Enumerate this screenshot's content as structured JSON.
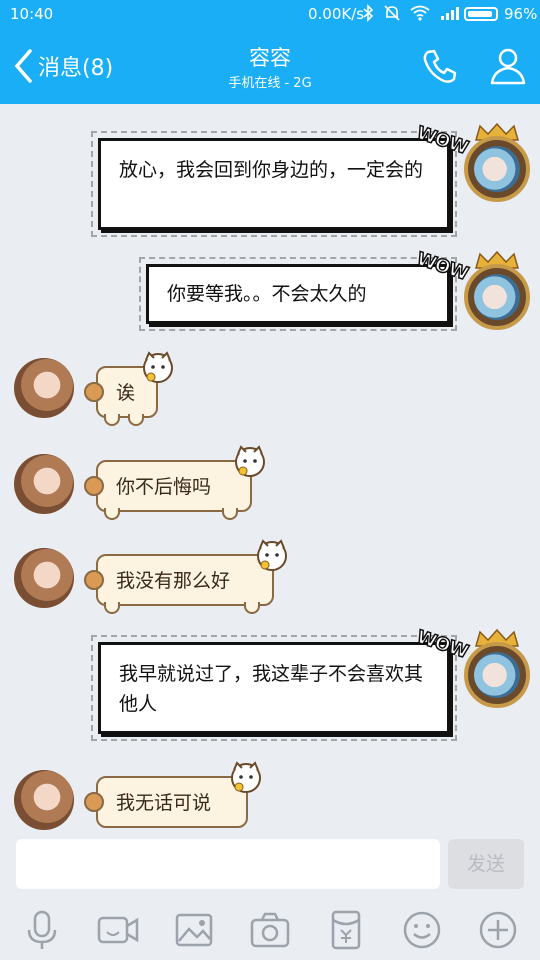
{
  "status_bar": {
    "time": "10:40",
    "network_speed": "0.00K/s",
    "battery_percent": "96%"
  },
  "header": {
    "back_label": "消息(8)",
    "title": "容容",
    "subtitle": "手机在线 - 2G"
  },
  "messages": [
    {
      "side": "right",
      "text": "放心，我会回到你身边的，一定会的",
      "sticker_text": "WOW"
    },
    {
      "side": "right",
      "text": "你要等我。。不会太久的",
      "sticker_text": "WOW"
    },
    {
      "side": "left",
      "text": "诶"
    },
    {
      "side": "left",
      "text": "你不后悔吗"
    },
    {
      "side": "left",
      "text": "我没有那么好"
    },
    {
      "side": "right",
      "text": "我早就说过了，我这辈子不会喜欢其他人",
      "sticker_text": "WOW"
    },
    {
      "side": "left",
      "text": "我无话可说"
    }
  ],
  "input": {
    "value": "",
    "send_label": "发送"
  },
  "toolbar": [
    "mic-icon",
    "video-icon",
    "image-icon",
    "camera-icon",
    "red-packet-icon",
    "emoji-icon",
    "plus-icon"
  ],
  "colors": {
    "accent": "#19aef5",
    "background": "#eaedf2"
  }
}
